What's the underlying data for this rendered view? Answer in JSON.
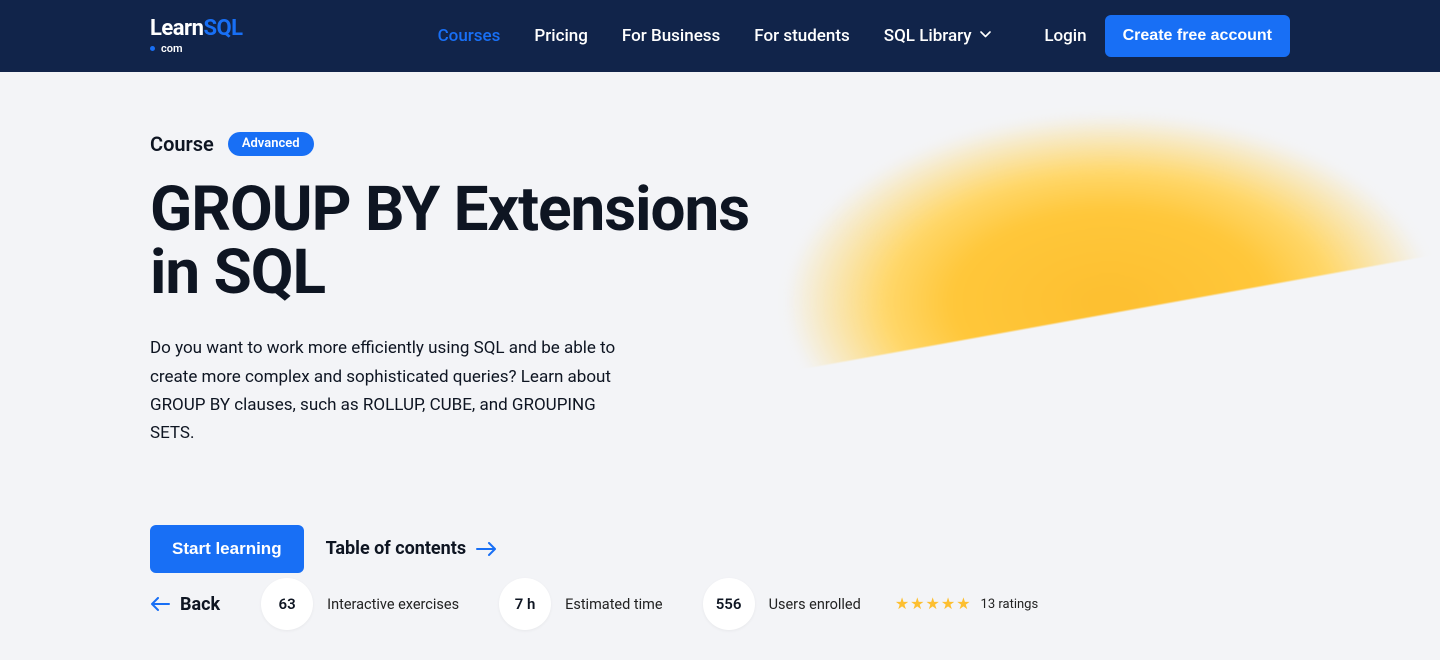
{
  "header": {
    "logo": {
      "brand_left": "Learn",
      "brand_right": "SQL",
      "sub": "com"
    },
    "nav": [
      {
        "label": "Courses",
        "active": true
      },
      {
        "label": "Pricing"
      },
      {
        "label": "For Business"
      },
      {
        "label": "For students"
      },
      {
        "label": "SQL Library",
        "dropdown": true
      }
    ],
    "login": "Login",
    "cta": "Create free account"
  },
  "hero": {
    "eyebrow": "Course",
    "badge": "Advanced",
    "title": "GROUP BY Extensions in SQL",
    "description": "Do you want to work more efficiently using SQL and be able to create more complex and sophisticated queries? Learn about GROUP BY clauses, such as ROLLUP, CUBE, and GROUPING SETS.",
    "start_btn": "Start learning",
    "toc": "Table of contents"
  },
  "stats": {
    "back": "Back",
    "items": [
      {
        "value": "63",
        "label": "Interactive exercises"
      },
      {
        "value": "7 h",
        "label": "Estimated time"
      },
      {
        "value": "556",
        "label": "Users enrolled"
      }
    ],
    "rating": {
      "stars": 5,
      "count_label": "13 ratings"
    }
  }
}
